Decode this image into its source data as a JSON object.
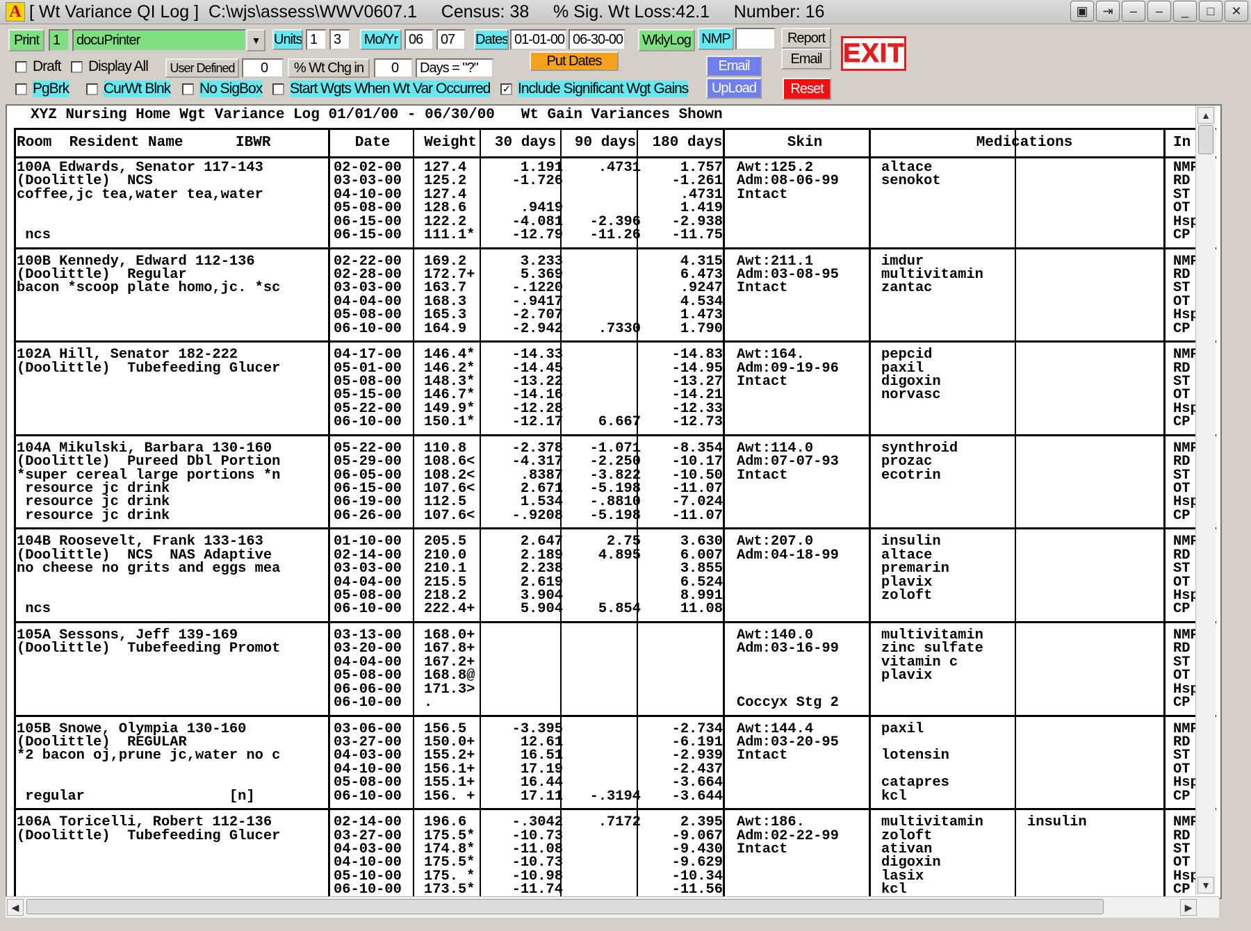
{
  "window": {
    "title": "[ Wt Variance QI Log ]  C:\\wjs\\assess\\WWV0607.1     Census: 38     % Sig. Wt Loss:42.1     Number: 16",
    "app_icon": "A",
    "buttons": [
      "▣",
      "⇥",
      "–",
      "–",
      "_",
      "□",
      "✕"
    ]
  },
  "toolbar": {
    "print_label": "Print",
    "print_copies": "1",
    "printer_value": "docuPrinter",
    "units_label": "Units",
    "units_a": "1",
    "units_b": "3",
    "moyr_label": "Mo/Yr",
    "mo_value": "06",
    "yr_value": "07",
    "dates_label": "Dates",
    "date_from": "01-01-00",
    "date_to": "06-30-00",
    "wklylog_label": "WklyLog",
    "nmp_label": "NMP",
    "nmp_value": "",
    "report_label": "Report",
    "email_label_top": "Email",
    "exit_label": "EXIT",
    "draft_label": "Draft",
    "display_all_label": "Display All",
    "user_defined_label": "User Defined",
    "user_defined_value": "0",
    "wt_chg_label": "% Wt Chg in",
    "wt_chg_value": "0",
    "days_value": "Days = \"?\"",
    "put_dates_label": "Put Dates",
    "email_label": "Email",
    "upload_label": "UpLoad",
    "reset_label": "Reset",
    "pgbrk_label": "PgBrk",
    "curwt_label": "CurWt Blnk",
    "nosig_label": "No SigBox",
    "start_wgts_label": "Start Wgts When Wt Var Occurred",
    "include_sig_label": "Include Significant Wgt Gains",
    "include_sig_checked": "✓"
  },
  "report": {
    "title": "XYZ Nursing Home Wgt Variance Log 01/01/00 - 06/30/00   Wt Gain Variances Shown",
    "headers": {
      "room": "Room  Resident Name      IBWR",
      "date": "Date",
      "weight": "Weight",
      "d30": "30 days",
      "d90": "90 days",
      "d180": "180 days",
      "skin": "Skin",
      "meds": "Medications",
      "in": "In"
    },
    "records": [
      {
        "resident": [
          "100A Edwards, Senator 117-143",
          "(Doolittle)  NCS",
          "coffee,jc tea,water tea,water",
          "",
          "",
          " ncs"
        ],
        "dates": [
          "02-02-00",
          "03-03-00",
          "04-10-00",
          "05-08-00",
          "06-15-00",
          "06-15-00"
        ],
        "weights": [
          "127.4",
          "125.2",
          "127.4",
          "128.6",
          "122.2",
          "111.1*"
        ],
        "d30": [
          "1.191",
          "-1.726",
          "",
          ".9419",
          "-4.081",
          "-12.79"
        ],
        "d90": [
          ".4731",
          "",
          "",
          "",
          "-2.396",
          "-11.26"
        ],
        "d180": [
          "1.757",
          "-1.261",
          ".4731",
          "1.419",
          "-2.938",
          "-11.75"
        ],
        "skin": [
          "Awt:125.2",
          "Adm:08-06-99",
          "Intact",
          "",
          "",
          ""
        ],
        "meds": [
          "altace",
          "senokot",
          "",
          "",
          "",
          ""
        ],
        "meds2": [
          "",
          "",
          "",
          "",
          "",
          ""
        ],
        "in": [
          "NMP",
          "RD",
          "ST",
          "OT",
          "Hsp",
          "CP"
        ]
      },
      {
        "resident": [
          "100B Kennedy, Edward 112-136",
          "(Doolittle)  Regular",
          "bacon *scoop plate homo,jc. *sc",
          "",
          "",
          ""
        ],
        "dates": [
          "02-22-00",
          "02-28-00",
          "03-03-00",
          "04-04-00",
          "05-08-00",
          "06-10-00"
        ],
        "weights": [
          "169.2",
          "172.7+",
          "163.7",
          "168.3",
          "165.3",
          "164.9"
        ],
        "d30": [
          "3.233",
          "5.369",
          "-.1220",
          "-.9417",
          "-2.707",
          "-2.942"
        ],
        "d90": [
          "",
          "",
          "",
          "",
          "",
          ".7330"
        ],
        "d180": [
          "4.315",
          "6.473",
          ".9247",
          "4.534",
          "1.473",
          "1.790"
        ],
        "skin": [
          "Awt:211.1",
          "Adm:03-08-95",
          "Intact",
          "",
          "",
          ""
        ],
        "meds": [
          "imdur",
          "multivitamin",
          "zantac",
          "",
          "",
          ""
        ],
        "meds2": [
          "",
          "",
          "",
          "",
          "",
          ""
        ],
        "in": [
          "NMP",
          "RD",
          "ST",
          "OT",
          "Hsp",
          "CP"
        ]
      },
      {
        "resident": [
          "102A Hill, Senator 182-222",
          "(Doolittle)  Tubefeeding Glucer",
          "",
          "",
          "",
          ""
        ],
        "dates": [
          "04-17-00",
          "05-01-00",
          "05-08-00",
          "05-15-00",
          "05-22-00",
          "06-10-00"
        ],
        "weights": [
          "146.4*",
          "146.2*",
          "148.3*",
          "146.7*",
          "149.9*",
          "150.1*"
        ],
        "d30": [
          "-14.33",
          "-14.45",
          "-13.22",
          "-14.16",
          "-12.28",
          "-12.17"
        ],
        "d90": [
          "",
          "",
          "",
          "",
          "",
          "6.667"
        ],
        "d180": [
          "-14.83",
          "-14.95",
          "-13.27",
          "-14.21",
          "-12.33",
          "-12.73"
        ],
        "skin": [
          "Awt:164.",
          "Adm:09-19-96",
          "Intact",
          "",
          "",
          ""
        ],
        "meds": [
          "pepcid",
          "paxil",
          "digoxin",
          "norvasc",
          "",
          ""
        ],
        "meds2": [
          "",
          "",
          "",
          "",
          "",
          ""
        ],
        "in": [
          "NMP",
          "RD",
          "ST",
          "OT",
          "Hsp",
          "CP"
        ]
      },
      {
        "resident": [
          "104A Mikulski, Barbara 130-160",
          "(Doolittle)  Pureed Dbl Portion",
          "*super cereal large portions *n",
          " resource jc drink",
          " resource jc drink",
          " resource jc drink"
        ],
        "dates": [
          "05-22-00",
          "05-29-00",
          "06-05-00",
          "06-15-00",
          "06-19-00",
          "06-26-00"
        ],
        "weights": [
          "110.8",
          "108.6<",
          "108.2<",
          "107.6<",
          "112.5",
          "107.6<"
        ],
        "d30": [
          "-2.378",
          "-4.317",
          ".8387",
          "2.671",
          "1.534",
          "-.9208"
        ],
        "d90": [
          "-1.071",
          "-2.250",
          "-3.822",
          "-5.198",
          "-.8810",
          "-5.198"
        ],
        "d180": [
          "-8.354",
          "-10.17",
          "-10.50",
          "-11.07",
          "-7.024",
          "-11.07"
        ],
        "skin": [
          "Awt:114.0",
          "Adm:07-07-93",
          "Intact",
          "",
          "",
          ""
        ],
        "meds": [
          "synthroid",
          "prozac",
          "ecotrin",
          "",
          "",
          ""
        ],
        "meds2": [
          "",
          "",
          "",
          "",
          "",
          ""
        ],
        "in": [
          "NMP",
          "RD",
          "ST",
          "OT",
          "Hsp",
          "CP"
        ]
      },
      {
        "resident": [
          "104B Roosevelt, Frank 133-163",
          "(Doolittle)  NCS  NAS Adaptive",
          "no cheese no grits and eggs mea",
          "",
          "",
          " ncs"
        ],
        "dates": [
          "01-10-00",
          "02-14-00",
          "03-03-00",
          "04-04-00",
          "05-08-00",
          "06-10-00"
        ],
        "weights": [
          "205.5",
          "210.0",
          "210.1",
          "215.5",
          "218.2",
          "222.4+"
        ],
        "d30": [
          "2.647",
          "2.189",
          "2.238",
          "2.619",
          "3.904",
          "5.904"
        ],
        "d90": [
          "2.75",
          "4.895",
          "",
          "",
          "",
          "5.854"
        ],
        "d180": [
          "3.630",
          "6.007",
          "3.855",
          "6.524",
          "8.991",
          "11.08"
        ],
        "skin": [
          "Awt:207.0",
          "Adm:04-18-99",
          "",
          "",
          "",
          ""
        ],
        "meds": [
          "insulin",
          "altace",
          "premarin",
          "plavix",
          "zoloft",
          ""
        ],
        "meds2": [
          "",
          "",
          "",
          "",
          "",
          ""
        ],
        "in": [
          "NMP",
          "RD",
          "ST",
          "OT",
          "Hsp",
          "CP"
        ]
      },
      {
        "resident": [
          "105A Sessons, Jeff 139-169",
          "(Doolittle)  Tubefeeding Promot",
          "",
          "",
          "",
          ""
        ],
        "dates": [
          "03-13-00",
          "03-20-00",
          "04-04-00",
          "05-08-00",
          "06-06-00",
          "06-10-00"
        ],
        "weights": [
          "168.0+",
          "167.8+",
          "167.2+",
          "168.8@",
          "171.3>",
          "."
        ],
        "d30": [
          "",
          "",
          "",
          "",
          "",
          ""
        ],
        "d90": [
          "",
          "",
          "",
          "",
          "",
          ""
        ],
        "d180": [
          "",
          "",
          "",
          "",
          "",
          ""
        ],
        "skin": [
          "Awt:140.0",
          "Adm:03-16-99",
          "",
          "",
          "",
          "Coccyx Stg 2"
        ],
        "meds": [
          "multivitamin",
          "zinc sulfate",
          "vitamin c",
          "plavix",
          "",
          ""
        ],
        "meds2": [
          "",
          "",
          "",
          "",
          "",
          ""
        ],
        "in": [
          "NMP",
          "RD",
          "ST",
          "OT",
          "Hsp",
          "CP"
        ]
      },
      {
        "resident": [
          "105B Snowe, Olympia 130-160",
          "(Doolittle)  REGULAR",
          "*2 bacon oj,prune jc,water no c",
          "",
          "",
          " regular                 [n]"
        ],
        "dates": [
          "03-06-00",
          "03-27-00",
          "04-03-00",
          "04-10-00",
          "05-08-00",
          "06-10-00"
        ],
        "weights": [
          "156.5",
          "150.0+",
          "155.2+",
          "156.1+",
          "155.1+",
          "156. +"
        ],
        "d30": [
          "-3.395",
          "12.61",
          "16.51",
          "17.19",
          "16.44",
          "17.11"
        ],
        "d90": [
          "",
          "",
          "",
          "",
          "",
          "-.3194"
        ],
        "d180": [
          "-2.734",
          "-6.191",
          "-2.939",
          "-2.437",
          "-3.664",
          "-3.644"
        ],
        "skin": [
          "Awt:144.4",
          "Adm:03-20-95",
          "Intact",
          "",
          "",
          ""
        ],
        "meds": [
          "paxil",
          "",
          "lotensin",
          "",
          "catapres",
          "kcl"
        ],
        "meds2": [
          "",
          "",
          "",
          "",
          "",
          ""
        ],
        "in": [
          "NMP",
          "RD",
          "ST",
          "OT",
          "Hsp",
          "CP"
        ]
      },
      {
        "resident": [
          "106A Toricelli, Robert 112-136",
          "(Doolittle)  Tubefeeding Glucer",
          "",
          "",
          "",
          ""
        ],
        "dates": [
          "02-14-00",
          "03-27-00",
          "04-03-00",
          "04-10-00",
          "05-10-00",
          "06-10-00"
        ],
        "weights": [
          "196.6",
          "175.5*",
          "174.8*",
          "175.5*",
          "175. *",
          "173.5*"
        ],
        "d30": [
          "-.3042",
          "-10.73",
          "-11.08",
          "-10.73",
          "-10.98",
          "-11.74"
        ],
        "d90": [
          ".7172",
          "",
          "",
          "",
          "",
          ""
        ],
        "d180": [
          "2.395",
          "-9.067",
          "-9.430",
          "-9.629",
          "-10.34",
          "-11.56"
        ],
        "skin": [
          "Awt:186.",
          "Adm:02-22-99",
          "Intact",
          "",
          "",
          ""
        ],
        "meds": [
          "multivitamin",
          "zoloft",
          "ativan",
          "digoxin",
          "lasix",
          "kcl"
        ],
        "meds2": [
          "insulin",
          "",
          "",
          "",
          "",
          ""
        ],
        "in": [
          "NMP",
          "RD",
          "ST",
          "OT",
          "Hsp",
          "CP"
        ]
      }
    ]
  }
}
